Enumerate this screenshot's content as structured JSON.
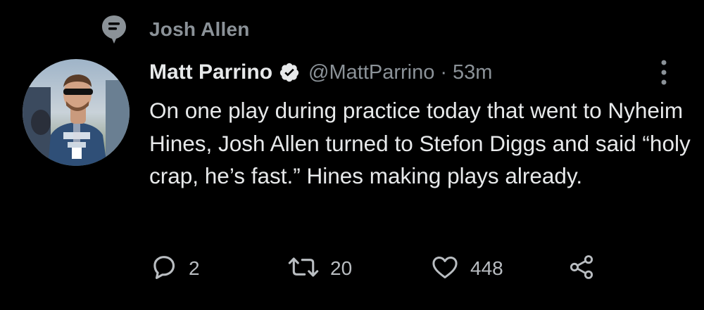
{
  "context": {
    "icon": "topic-pin-icon",
    "label": "Josh Allen"
  },
  "tweet": {
    "author": {
      "name": "Matt Parrino",
      "handle": "@MattParrino",
      "verified": true,
      "avatar": "profile-photo"
    },
    "separator": "·",
    "time": "53m",
    "text": "On one play during practice today that went to Nyheim Hines, Josh Allen turned to Stefon Diggs and said “holy crap, he’s fast.” Hines making plays already.",
    "actions": {
      "reply": {
        "icon": "reply-icon",
        "count": "2"
      },
      "retweet": {
        "icon": "retweet-icon",
        "count": "20"
      },
      "like": {
        "icon": "heart-icon",
        "count": "448"
      },
      "share": {
        "icon": "share-icon"
      }
    }
  },
  "colors": {
    "background": "#000000",
    "primary_text": "#e7e9ea",
    "secondary_text": "#8b9298",
    "verified_badge": "#e7e9ea"
  }
}
